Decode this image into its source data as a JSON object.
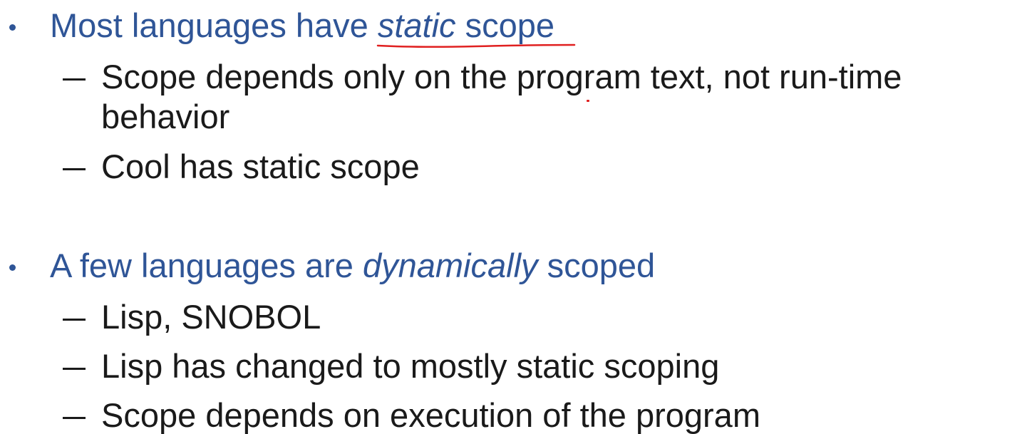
{
  "colors": {
    "heading": "#2f5597",
    "body": "#1a1a1a",
    "bullet": "#2f5597",
    "annotation": "#e02020"
  },
  "bullets": [
    {
      "pre": "Most languages have ",
      "emph": "static",
      "post": " scope",
      "subitems": [
        {
          "line1": "Scope depends only on the program text, not run-time",
          "line2": "behavior"
        },
        {
          "line1": "Cool has static scope"
        }
      ]
    },
    {
      "pre": "A few languages are ",
      "emph": "dynamically",
      "post": " scoped",
      "subitems": [
        {
          "line1": "Lisp, SNOBOL"
        },
        {
          "line1": "Lisp has changed to mostly static scoping"
        },
        {
          "line1": "Scope depends on execution of the program"
        }
      ]
    }
  ]
}
